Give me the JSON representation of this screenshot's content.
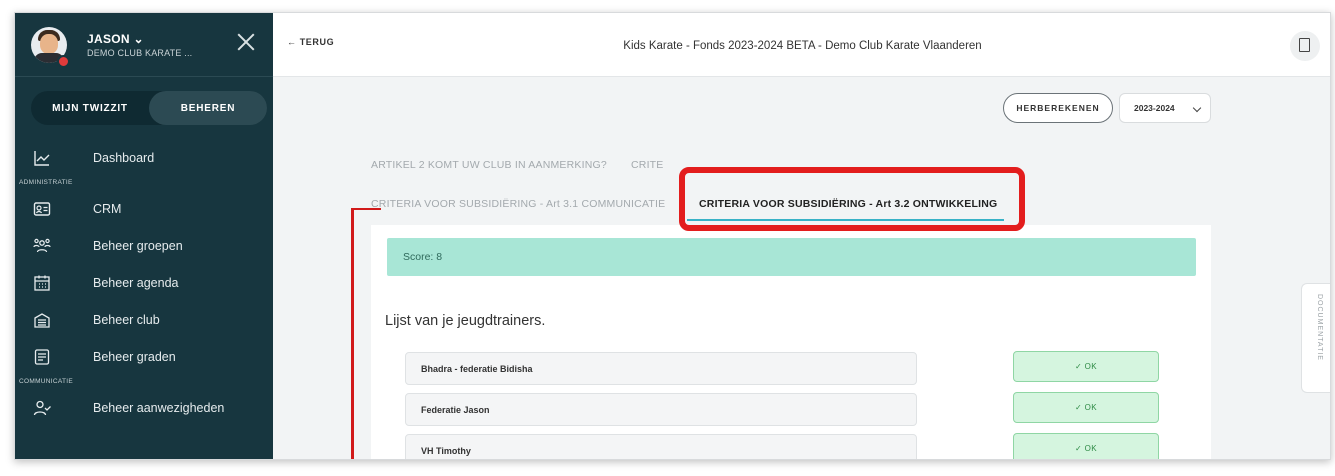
{
  "user": {
    "name": "JASON ⌄",
    "club": "DEMO CLUB KARATE ..."
  },
  "sidebar_tabs": [
    "MIJN TWIZZIT",
    "BEHEREN"
  ],
  "nav": {
    "dashboard": "Dashboard",
    "section_admin": "ADMINISTRATIE",
    "crm": "CRM",
    "groepen": "Beheer groepen",
    "agenda": "Beheer agenda",
    "club": "Beheer club",
    "graden": "Beheer graden",
    "section_comm": "COMMUNICATIE",
    "aanwezigheden": "Beheer aanwezigheden"
  },
  "topbar": {
    "back": "← TERUG",
    "title": "Kids Karate - Fonds 2023-2024 BETA - Demo Club Karate Vlaanderen"
  },
  "controls": {
    "recalc": "HERBEREKENEN",
    "year": "2023-2024"
  },
  "tabs": {
    "artikel2": "ARTIKEL 2 KOMT UW CLUB IN AANMERKING?",
    "crit_hidden": "CRITE",
    "art31": "CRITERIA VOOR SUBSIDIËRING - Art 3.1 COMMUNICATIE",
    "art32": "CRITERIA VOOR SUBSIDIËRING - Art 3.2 ONTWIKKELING"
  },
  "score": "Score: 8",
  "heading": "Lijst van je jeugdtrainers.",
  "trainers": [
    {
      "name": "Bhadra - federatie Bidisha",
      "status": "✓ OK"
    },
    {
      "name": "Federatie Jason",
      "status": "✓ OK"
    },
    {
      "name": "VH Timothy",
      "status": "✓ OK"
    }
  ],
  "side_tab": "DOCUMENTATIE",
  "colors": {
    "sidebar": "#17363f",
    "score": "#a8e6d6",
    "accent": "#38b2c7",
    "highlight": "#e31d1d",
    "ok": "#d5f5df"
  }
}
